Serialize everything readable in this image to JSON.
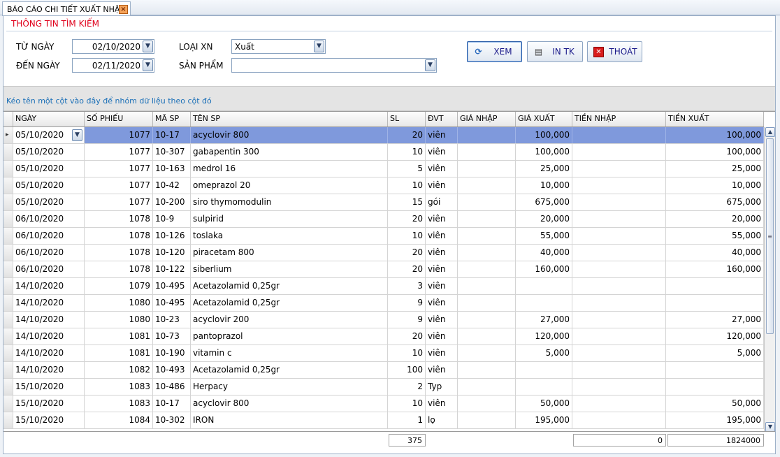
{
  "tab": {
    "title": "BÁO CÁO CHI TIẾT XUẤT NHẬP",
    "close": "×"
  },
  "search": {
    "title": "THÔNG TIN TÌM KIẾM",
    "from_label": "TỪ NGÀY",
    "from_value": "02/10/2020",
    "to_label": "ĐẾN NGÀY",
    "to_value": "02/11/2020",
    "type_label": "LOẠI XN",
    "type_value": "Xuất",
    "product_label": "SẢN PHẨM",
    "product_value": ""
  },
  "buttons": {
    "view": "XEM",
    "print": "IN TK",
    "exit": "THOÁT"
  },
  "group_hint": "Kéo tên một cột vào đây để nhóm dữ liệu theo cột đó",
  "columns": [
    "NGÀY",
    "SỐ PHIẾU",
    "MÃ SP",
    "TÊN SP",
    "SL",
    "ĐVT",
    "GIÁ NHẬP",
    "GIÁ XUẤT",
    "TIỀN NHẬP",
    "TIỀN XUẤT"
  ],
  "rows": [
    [
      "05/10/2020",
      "1077",
      "10-17",
      "acyclovir 800",
      "20",
      "viên",
      "",
      "100,000",
      "",
      "100,000"
    ],
    [
      "05/10/2020",
      "1077",
      "10-307",
      "gabapentin 300",
      "10",
      "viên",
      "",
      "100,000",
      "",
      "100,000"
    ],
    [
      "05/10/2020",
      "1077",
      "10-163",
      "medrol 16",
      "5",
      "viên",
      "",
      "25,000",
      "",
      "25,000"
    ],
    [
      "05/10/2020",
      "1077",
      "10-42",
      "omeprazol 20",
      "10",
      "viên",
      "",
      "10,000",
      "",
      "10,000"
    ],
    [
      "05/10/2020",
      "1077",
      "10-200",
      "siro thymomodulin",
      "15",
      "gói",
      "",
      "675,000",
      "",
      "675,000"
    ],
    [
      "06/10/2020",
      "1078",
      "10-9",
      "sulpirid",
      "20",
      "viên",
      "",
      "20,000",
      "",
      "20,000"
    ],
    [
      "06/10/2020",
      "1078",
      "10-126",
      "toslaka",
      "10",
      "viên",
      "",
      "55,000",
      "",
      "55,000"
    ],
    [
      "06/10/2020",
      "1078",
      "10-120",
      "piracetam 800",
      "20",
      "viên",
      "",
      "40,000",
      "",
      "40,000"
    ],
    [
      "06/10/2020",
      "1078",
      "10-122",
      "siberlium",
      "20",
      "viên",
      "",
      "160,000",
      "",
      "160,000"
    ],
    [
      "14/10/2020",
      "1079",
      "10-495",
      "Acetazolamid 0,25gr",
      "3",
      "viên",
      "",
      "",
      "",
      ""
    ],
    [
      "14/10/2020",
      "1080",
      "10-495",
      "Acetazolamid 0,25gr",
      "9",
      "viên",
      "",
      "",
      "",
      ""
    ],
    [
      "14/10/2020",
      "1080",
      "10-23",
      "acyclovir 200",
      "9",
      "viên",
      "",
      "27,000",
      "",
      "27,000"
    ],
    [
      "14/10/2020",
      "1081",
      "10-73",
      "pantoprazol",
      "20",
      "viên",
      "",
      "120,000",
      "",
      "120,000"
    ],
    [
      "14/10/2020",
      "1081",
      "10-190",
      "vitamin c",
      "10",
      "viên",
      "",
      "5,000",
      "",
      "5,000"
    ],
    [
      "14/10/2020",
      "1082",
      "10-493",
      "Acetazolamid 0,25gr",
      "100",
      "viên",
      "",
      "",
      "",
      ""
    ],
    [
      "15/10/2020",
      "1083",
      "10-486",
      "Herpacy",
      "2",
      "Typ",
      "",
      "",
      "",
      ""
    ],
    [
      "15/10/2020",
      "1083",
      "10-17",
      "acyclovir 800",
      "10",
      "viên",
      "",
      "50,000",
      "",
      "50,000"
    ],
    [
      "15/10/2020",
      "1084",
      "10-302",
      "IRON",
      "1",
      "lọ",
      "",
      "195,000",
      "",
      "195,000"
    ]
  ],
  "footer": {
    "sl_total": "375",
    "tien_nhap_total": "0",
    "tien_xuat_total": "1824000"
  },
  "colors": {
    "selected_row": "#7f99dc",
    "title_red": "#e0001b",
    "hint_blue": "#1a6fb7"
  }
}
